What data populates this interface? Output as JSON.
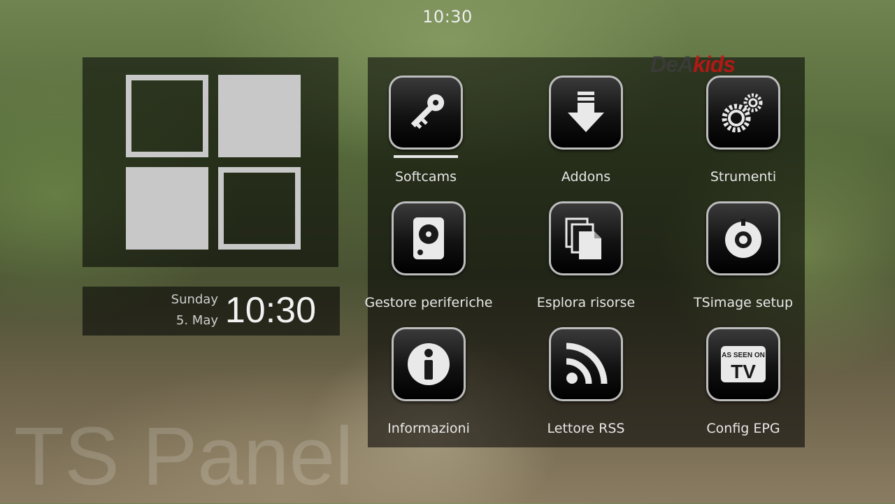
{
  "header": {
    "clock": "10:30"
  },
  "datetime": {
    "day": "Sunday",
    "date": "5. May",
    "time": "10:30"
  },
  "channel_logo": {
    "part1": "DeA",
    "part2": "kids"
  },
  "watermark": "TS Panel",
  "menu": {
    "selected": "Softcams",
    "items": [
      {
        "label": "Softcams",
        "icon": "key-icon"
      },
      {
        "label": "Addons",
        "icon": "download-icon"
      },
      {
        "label": "Strumenti",
        "icon": "gears-icon"
      },
      {
        "label": "Gestore periferiche",
        "icon": "harddisk-icon"
      },
      {
        "label": "Esplora risorse",
        "icon": "files-icon"
      },
      {
        "label": "TSimage setup",
        "icon": "dial-icon"
      },
      {
        "label": "Informazioni",
        "icon": "info-icon"
      },
      {
        "label": "Lettore RSS",
        "icon": "rss-icon"
      },
      {
        "label": "Config EPG",
        "icon": "tv-icon"
      }
    ],
    "tv_icon_text": {
      "line1": "AS SEEN ON",
      "line2": "TV"
    }
  }
}
